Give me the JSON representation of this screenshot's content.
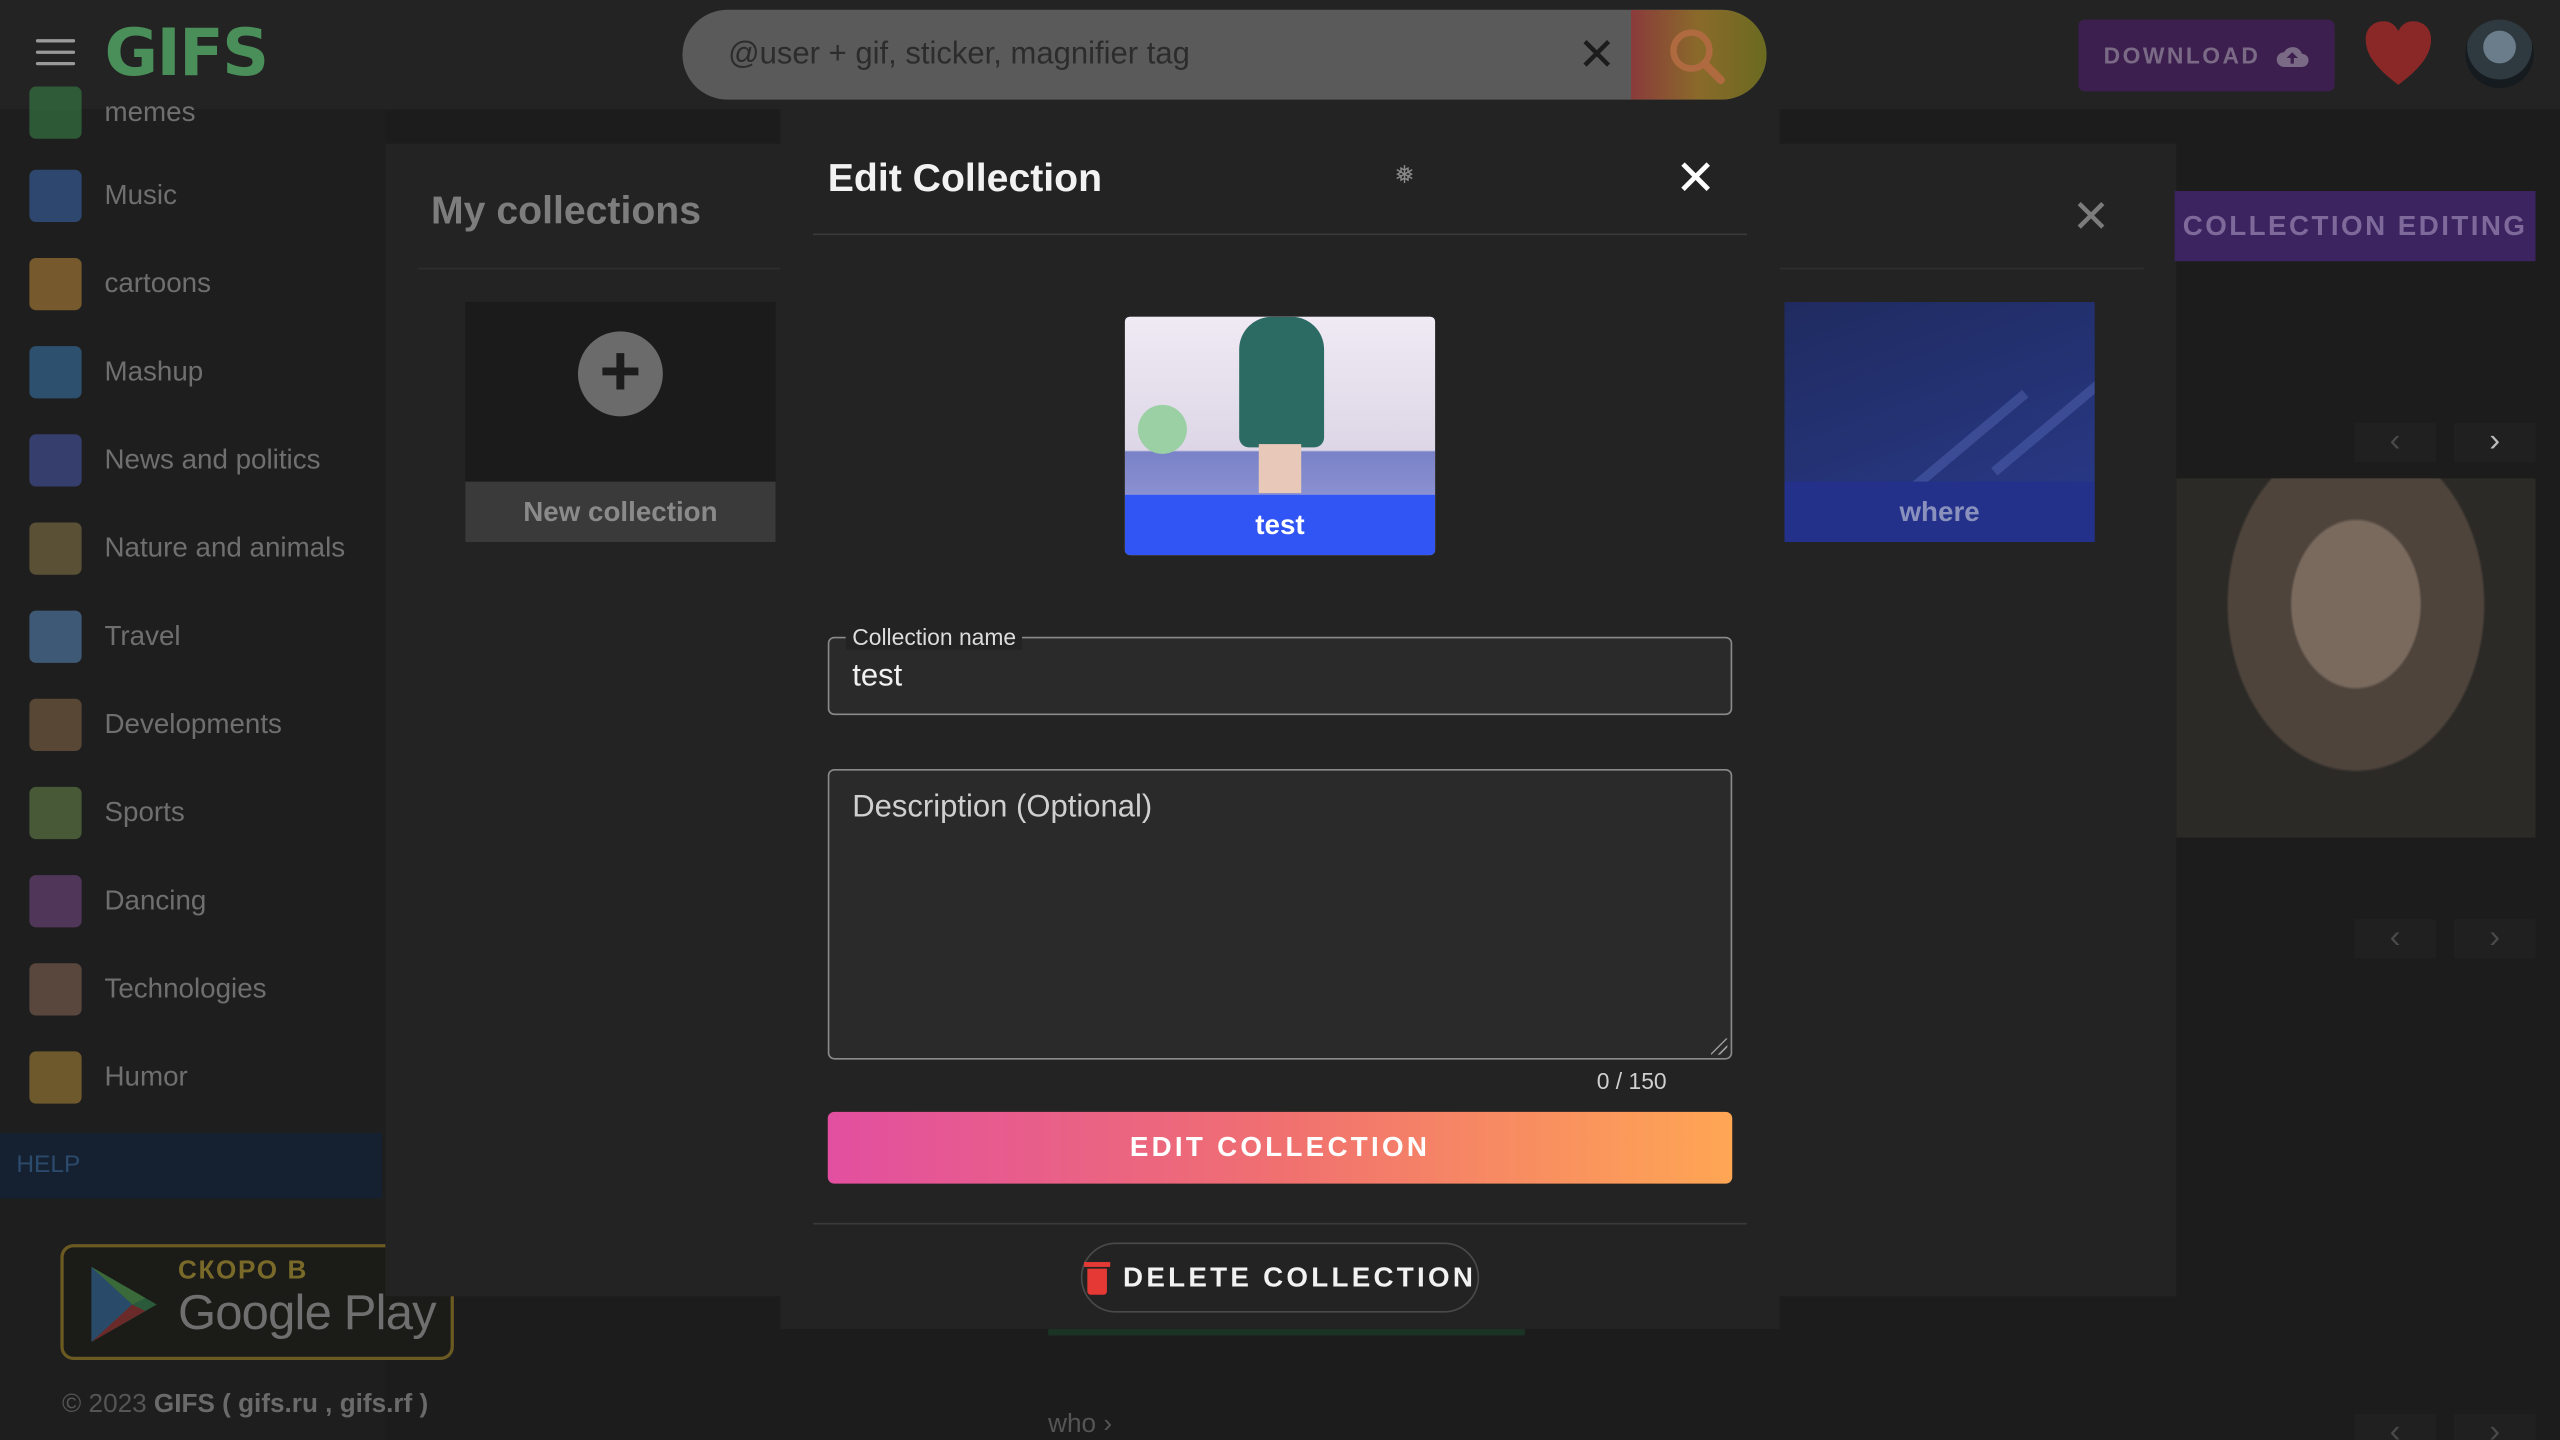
{
  "header": {
    "logo": "GIFS",
    "search_placeholder": "@user + gif, sticker, magnifier tag",
    "download_label": "DOWNLOAD"
  },
  "sidebar": {
    "items": [
      {
        "label": "memes",
        "color": "#3a8a4a"
      },
      {
        "label": "Music",
        "color": "#3a6ab0"
      },
      {
        "label": "cartoons",
        "color": "#c08a3a"
      },
      {
        "label": "Mashup",
        "color": "#3a7ab0"
      },
      {
        "label": "News and politics",
        "color": "#4a5ab0"
      },
      {
        "label": "Nature and animals",
        "color": "#8a7a4a"
      },
      {
        "label": "Travel",
        "color": "#5a8ac0"
      },
      {
        "label": "Developments",
        "color": "#8a6a4a"
      },
      {
        "label": "Sports",
        "color": "#6a8a4a"
      },
      {
        "label": "Dancing",
        "color": "#7a4a8a"
      },
      {
        "label": "Technologies",
        "color": "#8a6a5a"
      },
      {
        "label": "Humor",
        "color": "#b08a3a"
      }
    ],
    "help_label": "HELP",
    "gplay_small": "СКОРО В",
    "gplay_big": "Google Play",
    "copyright_prefix": "© 2023",
    "copyright_brand": "GIFS ( gifs.ru , gifs.rf )"
  },
  "panel": {
    "title": "My collections",
    "new_collection": "New collection",
    "where_label": "where",
    "collection_editing": "COLLECTION EDITING",
    "who_label": "who"
  },
  "modal": {
    "title": "Edit Collection",
    "preview_label": "test",
    "name_legend": "Collection name",
    "name_value": "test",
    "description_placeholder": "Description (Optional)",
    "counter": "0 / 150",
    "submit_label": "EDIT COLLECTION",
    "delete_label": "DELETE COLLECTION"
  }
}
